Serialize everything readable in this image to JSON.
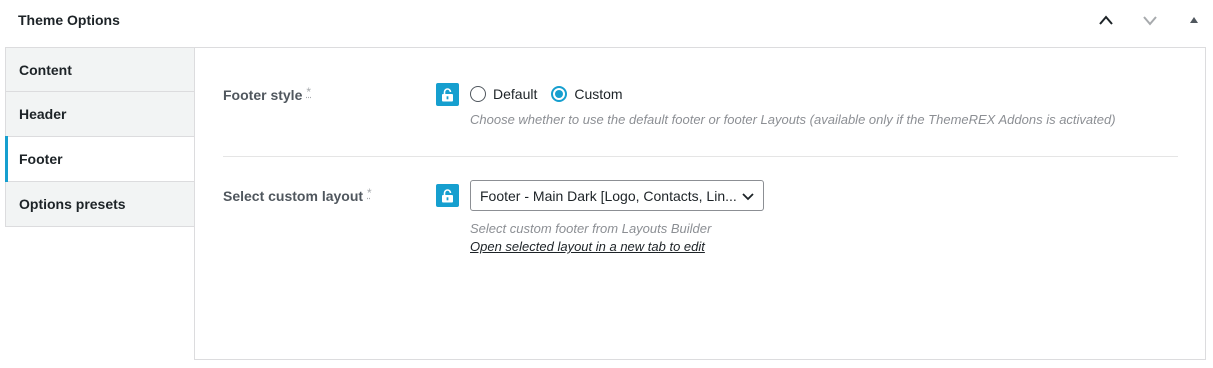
{
  "panel": {
    "title": "Theme Options",
    "controls": {
      "up_icon": "chevron-up-icon",
      "down_icon": "chevron-down-icon",
      "toggle_icon": "triangle-up-icon"
    }
  },
  "tabs": [
    {
      "label": "Content",
      "active": false
    },
    {
      "label": "Header",
      "active": false
    },
    {
      "label": "Footer",
      "active": true
    },
    {
      "label": "Options presets",
      "active": false
    }
  ],
  "fields": {
    "footer_style": {
      "label": "Footer style",
      "required_mark": "*",
      "lock_icon": "unlock-icon",
      "options": [
        {
          "label": "Default",
          "checked": false
        },
        {
          "label": "Custom",
          "checked": true
        }
      ],
      "description": "Choose whether to use the default footer or footer Layouts (available only if the ThemeREX Addons is activated)"
    },
    "custom_layout": {
      "label": "Select custom layout",
      "required_mark": "*",
      "lock_icon": "unlock-icon",
      "selected": "Footer - Main Dark [Logo, Contacts, Links, Socials]",
      "description": "Select custom footer from Layouts Builder",
      "link_text": "Open selected layout in a new tab to edit"
    }
  },
  "colors": {
    "accent": "#169fcf",
    "tab_bg": "#f2f4f4",
    "border": "#dcdcde"
  }
}
